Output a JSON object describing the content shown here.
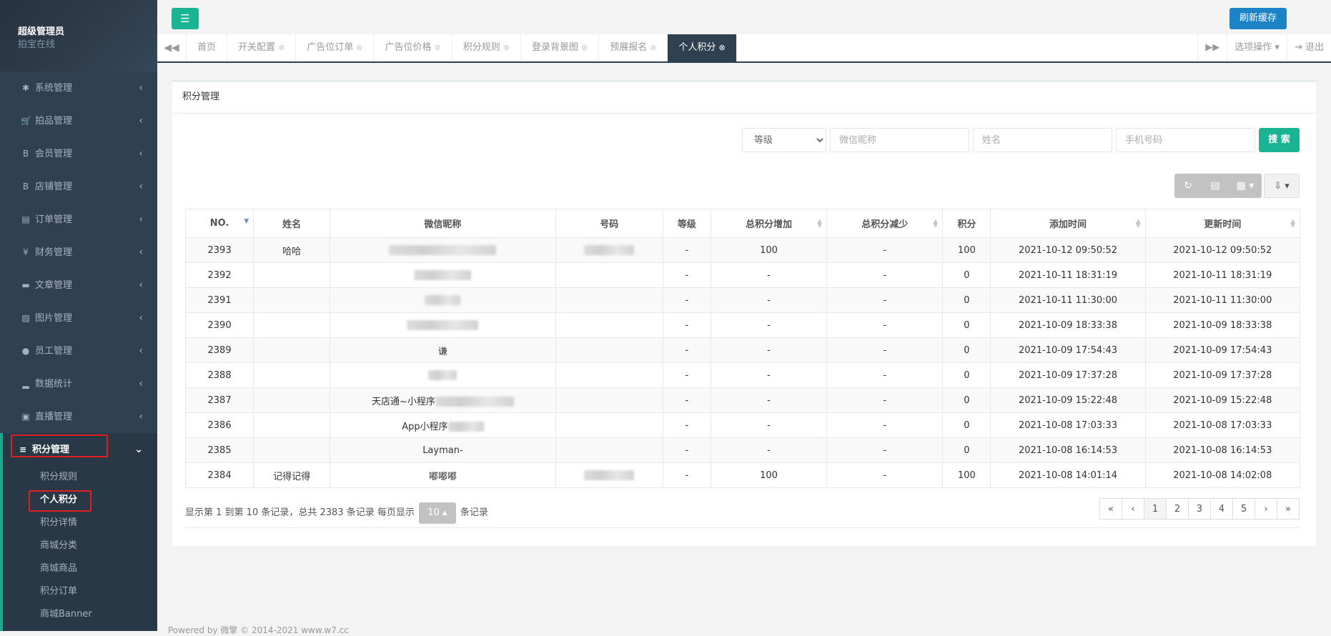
{
  "sidebar": {
    "profile": {
      "name": "超级管理员",
      "role": "拍宝在线"
    },
    "menu": [
      {
        "label": "系统管理",
        "icon": "gear-icon",
        "glyph": "✱"
      },
      {
        "label": "拍品管理",
        "icon": "cart-icon",
        "glyph": "🛒"
      },
      {
        "label": "会员管理",
        "icon": "bold-b-icon",
        "glyph": "B"
      },
      {
        "label": "店铺管理",
        "icon": "bold-b-icon",
        "glyph": "B"
      },
      {
        "label": "订单管理",
        "icon": "list-icon",
        "glyph": "▤"
      },
      {
        "label": "财务管理",
        "icon": "yen-icon",
        "glyph": "¥"
      },
      {
        "label": "文章管理",
        "icon": "folder-icon",
        "glyph": "▬"
      },
      {
        "label": "图片管理",
        "icon": "image-icon",
        "glyph": "▨"
      },
      {
        "label": "员工管理",
        "icon": "user-icon",
        "glyph": "●"
      },
      {
        "label": "数据统计",
        "icon": "bar-chart-icon",
        "glyph": "▂"
      },
      {
        "label": "直播管理",
        "icon": "tv-icon",
        "glyph": "▣"
      }
    ],
    "active_menu": {
      "label": "积分管理",
      "icon": "database-icon",
      "glyph": "≡"
    },
    "submenu": [
      "积分规则",
      "个人积分",
      "积分详情",
      "商城分类",
      "商城商品",
      "积分订单",
      "商城Banner"
    ]
  },
  "topbar": {
    "refresh_label": "刷新缓存",
    "tabs": [
      {
        "label": "首页",
        "closable": false
      },
      {
        "label": "开关配置",
        "closable": true
      },
      {
        "label": "广告位订单",
        "closable": true
      },
      {
        "label": "广告位价格",
        "closable": true
      },
      {
        "label": "积分规则",
        "closable": true
      },
      {
        "label": "登录背景图",
        "closable": true
      },
      {
        "label": "预展报名",
        "closable": true
      },
      {
        "label": "个人积分",
        "closable": true,
        "active": true
      }
    ],
    "options_label": "选项操作",
    "logout_label": "退出"
  },
  "panel": {
    "title": "积分管理",
    "search": {
      "level_select": "等级",
      "wechat_placeholder": "微信昵称",
      "name_placeholder": "姓名",
      "phone_placeholder": "手机号码",
      "button": "搜 索"
    }
  },
  "table": {
    "columns": [
      "NO.",
      "姓名",
      "微信昵称",
      "号码",
      "等级",
      "总积分增加",
      "总积分减少",
      "积分",
      "添加时间",
      "更新时间"
    ],
    "rows": [
      {
        "no": "2393",
        "name": "哈哈",
        "nick": "",
        "nick_blur": 150,
        "phone_blur": 70,
        "level": "-",
        "inc": "100",
        "dec": "-",
        "points": "100",
        "added": "2021-10-12 09:50:52",
        "updated": "2021-10-12 09:50:52"
      },
      {
        "no": "2392",
        "name": "",
        "nick": "",
        "nick_blur": 80,
        "phone_blur": 0,
        "level": "-",
        "inc": "-",
        "dec": "-",
        "points": "0",
        "added": "2021-10-11 18:31:19",
        "updated": "2021-10-11 18:31:19"
      },
      {
        "no": "2391",
        "name": "",
        "nick": "",
        "nick_blur": 50,
        "phone_blur": 0,
        "level": "-",
        "inc": "-",
        "dec": "-",
        "points": "0",
        "added": "2021-10-11 11:30:00",
        "updated": "2021-10-11 11:30:00"
      },
      {
        "no": "2390",
        "name": "",
        "nick": "",
        "nick_blur": 100,
        "phone_blur": 0,
        "level": "-",
        "inc": "-",
        "dec": "-",
        "points": "0",
        "added": "2021-10-09 18:33:38",
        "updated": "2021-10-09 18:33:38"
      },
      {
        "no": "2389",
        "name": "",
        "nick": "谦",
        "nick_blur": 0,
        "phone_blur": 0,
        "level": "-",
        "inc": "-",
        "dec": "-",
        "points": "0",
        "added": "2021-10-09 17:54:43",
        "updated": "2021-10-09 17:54:43"
      },
      {
        "no": "2388",
        "name": "",
        "nick": "",
        "nick_blur": 40,
        "phone_blur": 0,
        "level": "-",
        "inc": "-",
        "dec": "-",
        "points": "0",
        "added": "2021-10-09 17:37:28",
        "updated": "2021-10-09 17:37:28"
      },
      {
        "no": "2387",
        "name": "",
        "nick": "天店通~小程序",
        "nick_blur": 110,
        "phone_blur": 0,
        "level": "-",
        "inc": "-",
        "dec": "-",
        "points": "0",
        "added": "2021-10-09 15:22:48",
        "updated": "2021-10-09 15:22:48"
      },
      {
        "no": "2386",
        "name": "",
        "nick": "App小程序",
        "nick_blur": 50,
        "phone_blur": 0,
        "level": "-",
        "inc": "-",
        "dec": "-",
        "points": "0",
        "added": "2021-10-08 17:03:33",
        "updated": "2021-10-08 17:03:33"
      },
      {
        "no": "2385",
        "name": "",
        "nick": "Layman-",
        "nick_blur": 0,
        "phone_blur": 0,
        "level": "-",
        "inc": "-",
        "dec": "-",
        "points": "0",
        "added": "2021-10-08 16:14:53",
        "updated": "2021-10-08 16:14:53"
      },
      {
        "no": "2384",
        "name": "记得记得",
        "nick": "嘟嘟嘟",
        "nick_blur": 0,
        "phone_blur": 70,
        "level": "-",
        "inc": "100",
        "dec": "-",
        "points": "100",
        "added": "2021-10-08 14:01:14",
        "updated": "2021-10-08 14:02:08"
      }
    ]
  },
  "pager": {
    "info_prefix": "显示第 1 到第 10 条记录，总共 2383 条记录 每页显示",
    "page_size": "10",
    "info_suffix": "条记录",
    "pages": [
      "«",
      "‹",
      "1",
      "2",
      "3",
      "4",
      "5",
      "›",
      "»"
    ],
    "current": "1"
  },
  "footer": "Powered by 微擎 © 2014-2021 www.w7.cc",
  "colors": {
    "sidebar": "#2f4050",
    "accent": "#1ab394",
    "primary": "#1c84c6",
    "highlight": "#e02020"
  }
}
